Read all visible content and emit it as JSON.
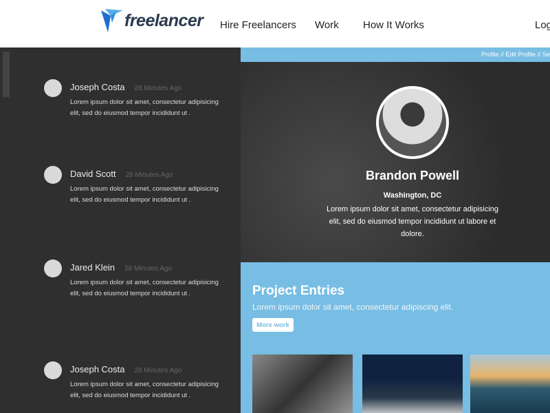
{
  "header": {
    "brand": "freelancer",
    "nav": [
      "Hire Freelancers",
      "Work",
      "How It Works",
      "Log"
    ]
  },
  "breadcrumb": "Profile // Edit Profile // Se",
  "comments": [
    {
      "name": "Joseph Costa",
      "time": "28 Minutes Ago",
      "text": "Lorem ipsum dolor sit amet, consectetur adipisicing elit, sed do eiusmod tempor incididunt ut ."
    },
    {
      "name": "David Scott",
      "time": "28 Minutes Ago",
      "text": "Lorem ipsum dolor sit amet, consectetur adipisicing elit, sed do eiusmod tempor incididunt ut ."
    },
    {
      "name": "Jared Klein",
      "time": "28 Minutes Ago",
      "text": "Lorem ipsum dolor sit amet, consectetur adipisicing elit, sed do eiusmod tempor incididunt ut ."
    },
    {
      "name": "Joseph Costa",
      "time": "28 Minutes Ago",
      "text": "Lorem ipsum dolor sit amet, consectetur adipisicing elit, sed do eiusmod tempor incididunt ut ."
    }
  ],
  "profile": {
    "name": "Brandon Powell",
    "location": "Washington, DC",
    "bio": "Lorem ipsum dolor sit amet, consectetur adipisicing elit, sed do eiusmod tempor incididunt ut labore et dolore."
  },
  "projects": {
    "title": "Project Entries",
    "subtitle": "Lorem ipsum dolor sit amet, consectetur adipiscing elit.",
    "button": "More work"
  },
  "colors": {
    "accent": "#78bde3",
    "dark": "#2f2f2f",
    "logo": "#1e88d8"
  }
}
